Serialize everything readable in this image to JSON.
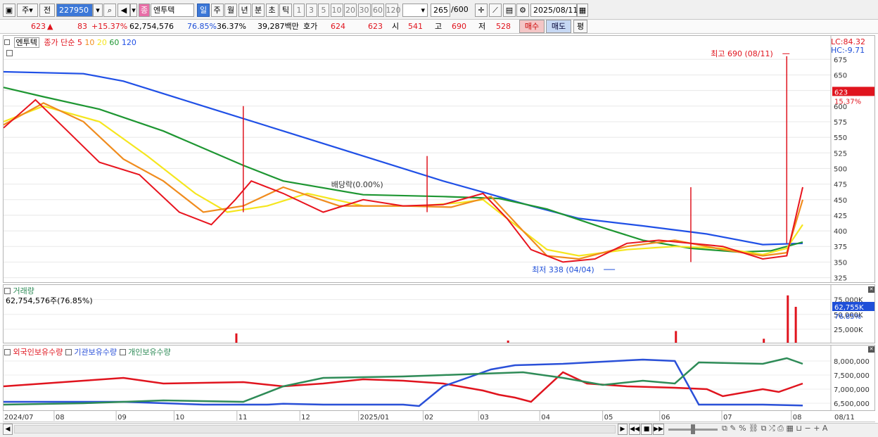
{
  "toolbar": {
    "period_main": "주",
    "period_prev": "전",
    "code": "227950",
    "stock_name": "엔투텍",
    "stock_badge": "종",
    "periods": [
      "일",
      "주",
      "월",
      "년",
      "분",
      "초",
      "틱"
    ],
    "active_period": "일",
    "intervals": [
      "1",
      "3",
      "5",
      "10",
      "20",
      "30",
      "60",
      "120"
    ],
    "count": "265",
    "count_total": "/600",
    "date": "2025/08/11"
  },
  "quote": {
    "price": "623",
    "arrow": "▲",
    "change": "83",
    "change_pct": "+15.37%",
    "volume": "62,754,576",
    "vol_ratio": "76.85%",
    "turnover": "36.37%",
    "amount": "39,287백만",
    "hoga_label": "호가",
    "ask": "624",
    "bid": "623",
    "open_label": "시",
    "open": "541",
    "high_label": "고",
    "high": "690",
    "low_label": "저",
    "low": "528",
    "buy_label": "매수",
    "sell_label": "매도",
    "avg_label": "평"
  },
  "price_panel": {
    "name": "엔투텍",
    "ma_title": "종가 단순",
    "ma_periods": [
      "5",
      "10",
      "20",
      "60",
      "120"
    ],
    "ma_colors": [
      "#e8141e",
      "#f08c1e",
      "#f5e61e",
      "#1e9632",
      "#2050e6"
    ],
    "lc": "LC:84.32",
    "hc": "HC:-9.71",
    "high_note": "최고 690 (08/11)",
    "low_note": "최저 338 (04/04)",
    "dividend_note": "배당락(0.00%)",
    "last_price": "623",
    "last_pct": "15.37%",
    "y_ticks": [
      "675",
      "650",
      "625",
      "600",
      "575",
      "550",
      "525",
      "500",
      "475",
      "450",
      "425",
      "400",
      "375",
      "350",
      "325"
    ]
  },
  "volume_panel": {
    "title": "거래량",
    "value_text": "62,754,576주(76.85%)",
    "y_ticks": [
      "75,000K",
      "50,000K",
      "25,000K"
    ],
    "last_value": "62,755K",
    "last_pct": "76.85%"
  },
  "holdings_panel": {
    "series_labels": [
      "외국인보유수량",
      "기관보유수량",
      "개인보유수량"
    ],
    "series_colors": [
      "#e0141e",
      "#2a50d8",
      "#2e8b57"
    ],
    "y_ticks": [
      "8,000,000",
      "7,500,000",
      "7,000,000",
      "6,500,000"
    ]
  },
  "x_axis": {
    "labels": [
      "2024/07",
      "08",
      "09",
      "10",
      "11",
      "12",
      "2025/01",
      "02",
      "03",
      "04",
      "05",
      "06",
      "07",
      "08"
    ],
    "end_label": "08/11"
  },
  "chart_data": {
    "type": "line",
    "price_range": [
      320,
      690
    ],
    "ma_anchors": {
      "ma120": [
        [
          0,
          655
        ],
        [
          0.1,
          652
        ],
        [
          0.15,
          640
        ],
        [
          0.25,
          600
        ],
        [
          0.35,
          560
        ],
        [
          0.45,
          520
        ],
        [
          0.55,
          480
        ],
        [
          0.6,
          462
        ],
        [
          0.66,
          440
        ],
        [
          0.72,
          420
        ],
        [
          0.8,
          408
        ],
        [
          0.88,
          395
        ],
        [
          0.95,
          378
        ],
        [
          1,
          380
        ]
      ],
      "ma60": [
        [
          0,
          630
        ],
        [
          0.05,
          615
        ],
        [
          0.12,
          595
        ],
        [
          0.2,
          560
        ],
        [
          0.3,
          505
        ],
        [
          0.35,
          480
        ],
        [
          0.45,
          458
        ],
        [
          0.55,
          455
        ],
        [
          0.62,
          452
        ],
        [
          0.68,
          435
        ],
        [
          0.75,
          405
        ],
        [
          0.8,
          385
        ],
        [
          0.86,
          372
        ],
        [
          0.92,
          366
        ],
        [
          0.96,
          368
        ],
        [
          1,
          382
        ]
      ],
      "ma20": [
        [
          0,
          575
        ],
        [
          0.05,
          600
        ],
        [
          0.12,
          575
        ],
        [
          0.18,
          520
        ],
        [
          0.24,
          460
        ],
        [
          0.28,
          430
        ],
        [
          0.33,
          440
        ],
        [
          0.38,
          460
        ],
        [
          0.45,
          440
        ],
        [
          0.52,
          440
        ],
        [
          0.57,
          445
        ],
        [
          0.6,
          450
        ],
        [
          0.64,
          410
        ],
        [
          0.68,
          370
        ],
        [
          0.72,
          360
        ],
        [
          0.78,
          370
        ],
        [
          0.84,
          375
        ],
        [
          0.9,
          372
        ],
        [
          0.95,
          362
        ],
        [
          0.98,
          372
        ],
        [
          1,
          410
        ]
      ],
      "ma10": [
        [
          0,
          570
        ],
        [
          0.05,
          605
        ],
        [
          0.1,
          575
        ],
        [
          0.15,
          515
        ],
        [
          0.2,
          480
        ],
        [
          0.25,
          430
        ],
        [
          0.3,
          440
        ],
        [
          0.35,
          470
        ],
        [
          0.42,
          440
        ],
        [
          0.5,
          440
        ],
        [
          0.56,
          438
        ],
        [
          0.61,
          455
        ],
        [
          0.65,
          400
        ],
        [
          0.68,
          360
        ],
        [
          0.72,
          355
        ],
        [
          0.78,
          375
        ],
        [
          0.84,
          385
        ],
        [
          0.9,
          370
        ],
        [
          0.95,
          360
        ],
        [
          0.98,
          365
        ],
        [
          1,
          450
        ]
      ],
      "ma5": [
        [
          0,
          565
        ],
        [
          0.04,
          610
        ],
        [
          0.08,
          560
        ],
        [
          0.12,
          510
        ],
        [
          0.17,
          490
        ],
        [
          0.22,
          430
        ],
        [
          0.26,
          410
        ],
        [
          0.29,
          450
        ],
        [
          0.31,
          480
        ],
        [
          0.35,
          460
        ],
        [
          0.4,
          430
        ],
        [
          0.45,
          450
        ],
        [
          0.5,
          440
        ],
        [
          0.55,
          442
        ],
        [
          0.6,
          460
        ],
        [
          0.63,
          420
        ],
        [
          0.66,
          370
        ],
        [
          0.7,
          350
        ],
        [
          0.74,
          355
        ],
        [
          0.78,
          380
        ],
        [
          0.82,
          385
        ],
        [
          0.86,
          380
        ],
        [
          0.9,
          375
        ],
        [
          0.95,
          355
        ],
        [
          0.98,
          360
        ],
        [
          1,
          470
        ]
      ]
    },
    "volume_spikes": [
      [
        0.29,
        18000
      ],
      [
        0.63,
        6000
      ],
      [
        0.84,
        22000
      ],
      [
        0.95,
        9000
      ],
      [
        0.98,
        82000
      ],
      [
        0.99,
        62755
      ]
    ],
    "holdings": {
      "foreign": [
        [
          0,
          7.1
        ],
        [
          0.1,
          7.3
        ],
        [
          0.15,
          7.4
        ],
        [
          0.2,
          7.2
        ],
        [
          0.3,
          7.25
        ],
        [
          0.35,
          7.1
        ],
        [
          0.4,
          7.2
        ],
        [
          0.45,
          7.35
        ],
        [
          0.5,
          7.3
        ],
        [
          0.55,
          7.2
        ],
        [
          0.6,
          6.95
        ],
        [
          0.62,
          6.8
        ],
        [
          0.64,
          6.7
        ],
        [
          0.66,
          6.55
        ],
        [
          0.7,
          7.6
        ],
        [
          0.73,
          7.2
        ],
        [
          0.78,
          7.1
        ],
        [
          0.84,
          7.05
        ],
        [
          0.88,
          7.0
        ],
        [
          0.9,
          6.75
        ],
        [
          0.95,
          7.0
        ],
        [
          0.97,
          6.9
        ],
        [
          1,
          7.2
        ]
      ],
      "institution": [
        [
          0,
          6.55
        ],
        [
          0.15,
          6.55
        ],
        [
          0.25,
          6.45
        ],
        [
          0.33,
          6.45
        ],
        [
          0.35,
          6.48
        ],
        [
          0.4,
          6.45
        ],
        [
          0.5,
          6.45
        ],
        [
          0.52,
          6.4
        ],
        [
          0.55,
          7.1
        ],
        [
          0.58,
          7.4
        ],
        [
          0.61,
          7.7
        ],
        [
          0.64,
          7.85
        ],
        [
          0.7,
          7.9
        ],
        [
          0.8,
          8.05
        ],
        [
          0.84,
          8.0
        ],
        [
          0.87,
          6.45
        ],
        [
          0.95,
          6.45
        ],
        [
          1,
          6.42
        ]
      ],
      "individual": [
        [
          0,
          6.45
        ],
        [
          0.1,
          6.5
        ],
        [
          0.2,
          6.6
        ],
        [
          0.3,
          6.55
        ],
        [
          0.35,
          7.1
        ],
        [
          0.4,
          7.4
        ],
        [
          0.5,
          7.45
        ],
        [
          0.55,
          7.5
        ],
        [
          0.6,
          7.55
        ],
        [
          0.65,
          7.6
        ],
        [
          0.7,
          7.4
        ],
        [
          0.75,
          7.15
        ],
        [
          0.8,
          7.3
        ],
        [
          0.84,
          7.2
        ],
        [
          0.87,
          7.95
        ],
        [
          0.95,
          7.9
        ],
        [
          0.98,
          8.1
        ],
        [
          1,
          7.9
        ]
      ]
    }
  }
}
